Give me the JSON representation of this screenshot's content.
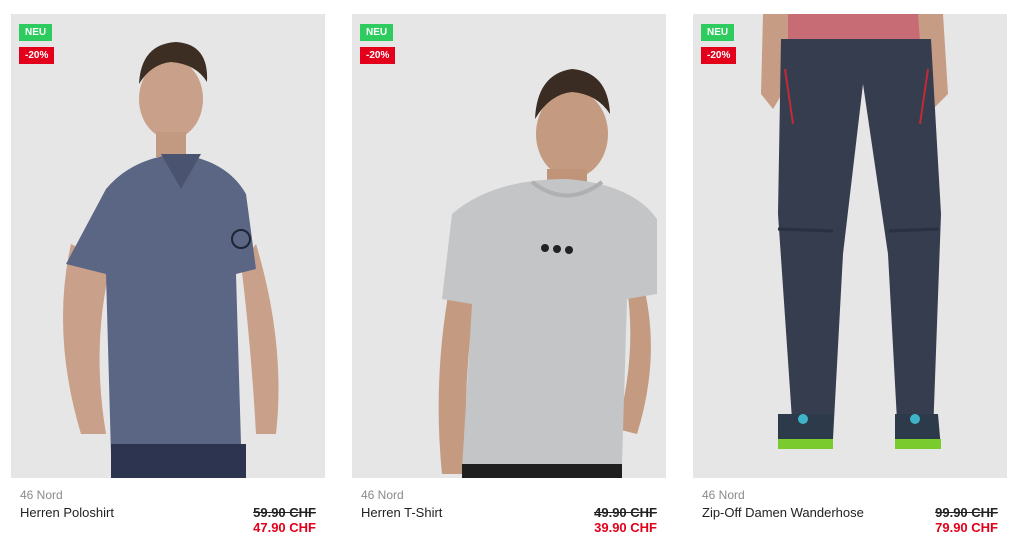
{
  "products": [
    {
      "badge_new": "NEU",
      "badge_discount": "-20%",
      "brand": "46 Nord",
      "name": "Herren Poloshirt",
      "price_old": "59.90 CHF",
      "price_new": "47.90 CHF",
      "image_description": "man-navy-polo-shirt"
    },
    {
      "badge_new": "NEU",
      "badge_discount": "-20%",
      "brand": "46 Nord",
      "name": "Herren T-Shirt",
      "price_old": "49.90 CHF",
      "price_new": "39.90 CHF",
      "image_description": "man-grey-tshirt"
    },
    {
      "badge_new": "NEU",
      "badge_discount": "-20%",
      "brand": "46 Nord",
      "name": "Zip-Off Damen Wanderhose",
      "price_old": "99.90 CHF",
      "price_new": "79.90 CHF",
      "image_description": "woman-dark-hiking-pants"
    }
  ],
  "colors": {
    "badge_new": "#2ecc5e",
    "badge_discount": "#e2001a",
    "price_new": "#e2001a",
    "brand": "#8a8a8a",
    "image_bg": "#e6e6e6"
  }
}
